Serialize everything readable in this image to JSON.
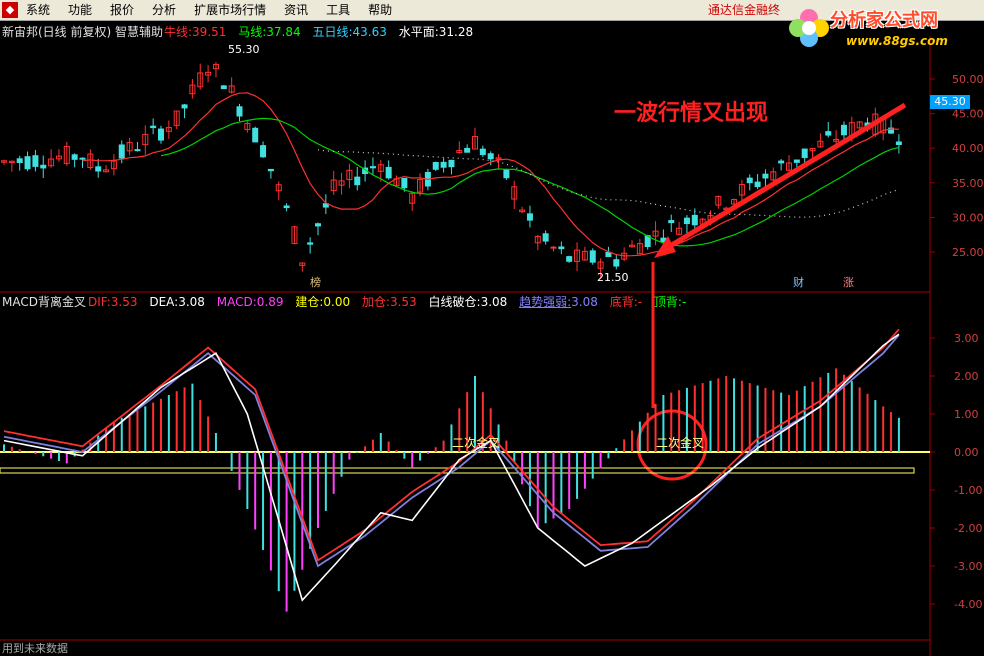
{
  "menu": {
    "items": [
      "系统",
      "功能",
      "报价",
      "分析",
      "扩展市场行情",
      "资讯",
      "工具",
      "帮助"
    ],
    "right_link": "通达信金融终",
    "brand_name": "分析家公式网",
    "brand_url": "www.88gs.com"
  },
  "price_panel": {
    "stock_title": "新宙邦(日线 前复权) 智慧辅助",
    "ma_labels": [
      {
        "label": "牛线:",
        "value": "39.51",
        "color": "#ff3030"
      },
      {
        "label": "马线:",
        "value": "37.84",
        "color": "#00ff00"
      },
      {
        "label": "五日线:",
        "value": "43.63",
        "color": "#30d0ff"
      },
      {
        "label": "水平面:",
        "value": "31.28",
        "color": "#ffffff"
      }
    ],
    "axis_ticks": [
      "50.00",
      "45.00",
      "40.00",
      "35.00",
      "30.00",
      "25.00"
    ],
    "current_price": "45.30",
    "high_marker": "55.30",
    "low_marker": "21.50",
    "annotation": "一波行情又出现",
    "badges": [
      "榜",
      "财",
      "涨"
    ]
  },
  "macd_panel": {
    "title": "MACD背离金叉",
    "indicators": [
      {
        "label": "DIF:",
        "value": "3.53",
        "color": "#ff3030"
      },
      {
        "label": "DEA:",
        "value": "3.08",
        "color": "#ffffff"
      },
      {
        "label": "MACD:",
        "value": "0.89",
        "color": "#ff40ff"
      },
      {
        "label": "建仓:",
        "value": "0.00",
        "color": "#ffff00"
      },
      {
        "label": "加仓:",
        "value": "3.53",
        "color": "#ff3030"
      },
      {
        "label": "白线破仓:",
        "value": "3.08",
        "color": "#ffffff"
      },
      {
        "label": "趋势强弱:",
        "value": "3.08",
        "color": "#8080ff"
      },
      {
        "label": "底背:",
        "value": "-",
        "color": "#ff3030"
      },
      {
        "label": "顶背:",
        "value": "-",
        "color": "#00ff00"
      }
    ],
    "axis_ticks": [
      "3.00",
      "2.00",
      "1.00",
      "0.00",
      "-1.00",
      "-2.00",
      "-3.00",
      "-4.00"
    ],
    "labels": [
      "二次金叉",
      "二次金叉"
    ]
  },
  "status": "用到未来数据",
  "colors": {
    "up": "#ff3030",
    "down": "#40e0e0",
    "annotation": "#ff2020",
    "dif": "#ffffff",
    "dea": "#ffff80"
  }
}
